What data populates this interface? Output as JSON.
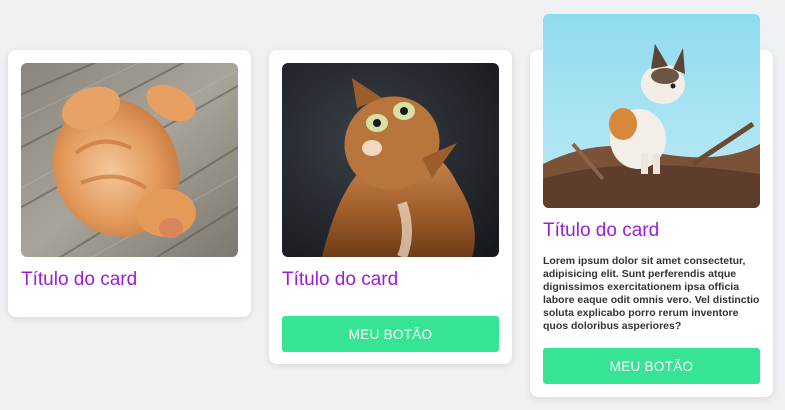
{
  "colors": {
    "background": "#f0f1f4",
    "card": "#ffffff",
    "title": "#9a1ddf",
    "button": "#37e394",
    "button_text": "#ffffff"
  },
  "cards": [
    {
      "image": "orange-cat-on-wooden-deck",
      "title": "Título do card"
    },
    {
      "image": "ginger-cat-looking-up",
      "title": "Título do card",
      "button_label": "MEU BOTÃO"
    },
    {
      "image": "calico-kitten-on-branch-blue-sky",
      "title": "Título do card",
      "text": "Lorem ipsum dolor sit amet consectetur, adipisicing elit. Sunt perferendis atque dignissimos exercitationem ipsa officia labore eaque odit omnis vero. Vel distinctio soluta explicabo porro rerum inventore quos doloribus asperiores?",
      "button_label": "MEU BOTÃO"
    }
  ]
}
